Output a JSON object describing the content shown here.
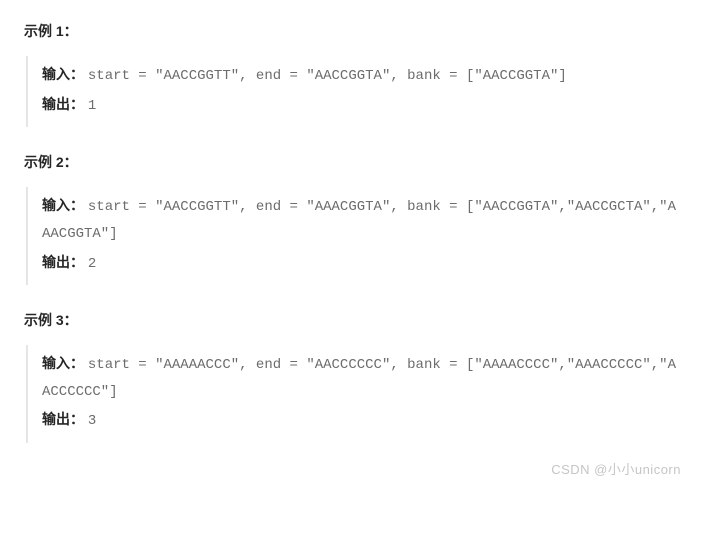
{
  "examples": [
    {
      "title": "示例 1：",
      "input_label": "输入：",
      "input_code": "start = \"AACCGGTT\", end = \"AACCGGTA\", bank = [\"AACCGGTA\"]",
      "output_label": "输出：",
      "output_code": "1"
    },
    {
      "title": "示例 2：",
      "input_label": "输入：",
      "input_code": "start = \"AACCGGTT\", end = \"AAACGGTA\", bank = [\"AACCGGTA\",\"AACCGCTA\",\"AAACGGTA\"]",
      "output_label": "输出：",
      "output_code": "2"
    },
    {
      "title": "示例 3：",
      "input_label": "输入：",
      "input_code": "start = \"AAAAACCC\", end = \"AACCCCCC\", bank = [\"AAAACCCC\",\"AAACCCCC\",\"AACCCCCC\"]",
      "output_label": "输出：",
      "output_code": "3"
    }
  ],
  "watermark": "CSDN @小小unicorn"
}
